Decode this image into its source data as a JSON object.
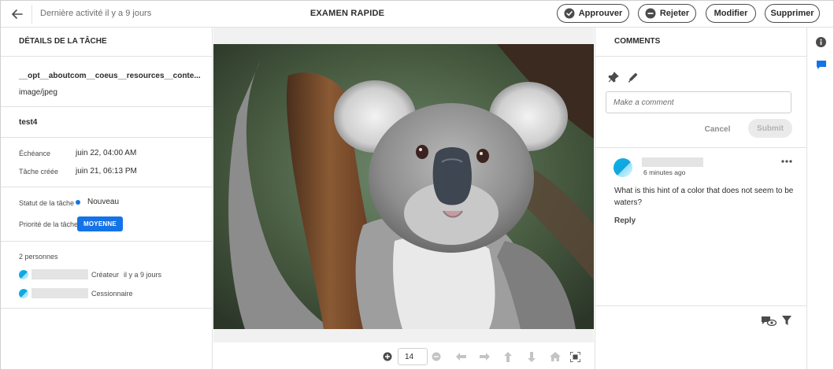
{
  "topbar": {
    "last_activity": "Dernière activité il y a 9 jours",
    "title": "EXAMEN RAPIDE",
    "buttons": {
      "approve": "Approuver",
      "reject": "Rejeter",
      "modify": "Modifier",
      "delete": "Supprimer"
    }
  },
  "task": {
    "header": "DÉTAILS DE LA TÂCHE",
    "file_name": "__opt__aboutcom__coeus__resources__conte...",
    "file_type": "image/jpeg",
    "task_name": "test4",
    "due_label": "Échéance",
    "due_value": "juin 22, 04:00 AM",
    "created_label": "Tâche créée",
    "created_value": "juin 21, 06:13 PM",
    "status_label": "Statut de la tâche",
    "status_value": "Nouveau",
    "priority_label": "Priorité de la tâche",
    "priority_value": "MOYENNE",
    "people_count": "2 personnes",
    "people": [
      {
        "role": "Créateur",
        "when": "il y a 9 jours"
      },
      {
        "role": "Cessionnaire",
        "when": ""
      }
    ]
  },
  "viewer": {
    "zoom_value": "14"
  },
  "comments": {
    "header": "COMMENTS",
    "input_placeholder": "Make a comment",
    "cancel_label": "Cancel",
    "submit_label": "Submit",
    "items": [
      {
        "time": "6 minutes ago",
        "text": "What is this hint of a color that does not seem to be waters?",
        "reply_label": "Reply"
      }
    ]
  },
  "colors": {
    "accent": "#1473e6",
    "border": "#e1e1e1",
    "text": "#2c2c2c"
  },
  "icons": [
    "arrow-left-icon",
    "checkmark-circle-icon",
    "minus-circle-icon",
    "pin-icon",
    "pencil-icon",
    "more-icon",
    "comment-visibility-icon",
    "filter-icon",
    "info-icon",
    "comment-icon",
    "zoom-in-icon",
    "zoom-out-icon",
    "previous-icon",
    "next-icon",
    "up-icon",
    "down-icon",
    "home-icon",
    "fit-screen-icon"
  ]
}
